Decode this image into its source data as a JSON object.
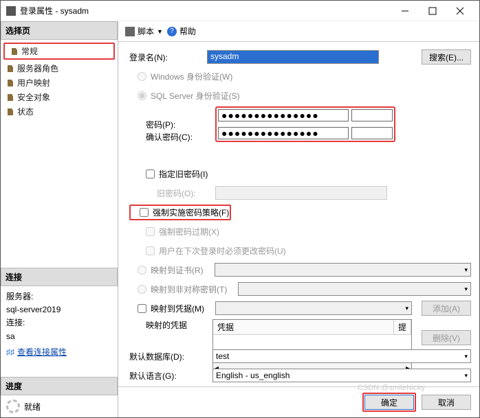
{
  "titlebar": {
    "title": "登录属性 - sysadm"
  },
  "left": {
    "select_page": "选择页",
    "nav": [
      {
        "label": "常规"
      },
      {
        "label": "服务器角色"
      },
      {
        "label": "用户映射"
      },
      {
        "label": "安全对象"
      },
      {
        "label": "状态"
      }
    ],
    "connection": {
      "head": "连接",
      "server_label": "服务器:",
      "server_value": "sql-server2019",
      "conn_label": "连接:",
      "conn_value": "sa",
      "view_props": "查看连接属性"
    },
    "progress": {
      "head": "进度",
      "status": "就绪"
    }
  },
  "toolbar": {
    "script": "脚本",
    "help": "帮助"
  },
  "form": {
    "login_name_label": "登录名(N):",
    "login_name_value": "sysadm",
    "search_btn": "搜索(E)...",
    "auth_windows": "Windows 身份验证(W)",
    "auth_sql": "SQL Server 身份验证(S)",
    "password_label": "密码(P):",
    "password_value": "●●●●●●●●●●●●●●●",
    "confirm_label": "确认密码(C):",
    "confirm_value": "●●●●●●●●●●●●●●●",
    "specify_old": "指定旧密码(I)",
    "old_password_label": "旧密码(O):",
    "enforce_policy": "强制实施密码策略(F)",
    "enforce_expiration": "强制密码过期(X)",
    "must_change": "用户在下次登录时必须更改密码(U)",
    "map_cert": "映射到证书(R)",
    "map_asym": "映射到非对称密钥(T)",
    "map_cred": "映射到凭据(M)",
    "add_btn": "添加(A)",
    "mapped_cred_label": "映射的凭据",
    "cred_col1": "凭据",
    "cred_col2": "提",
    "delete_btn": "删除(V)",
    "default_db_label": "默认数据库(D):",
    "default_db_value": "test",
    "default_lang_label": "默认语言(G):",
    "default_lang_value": "English - us_english"
  },
  "footer": {
    "ok": "确定",
    "cancel": "取消"
  },
  "watermark": "CSDN @smileNicky"
}
